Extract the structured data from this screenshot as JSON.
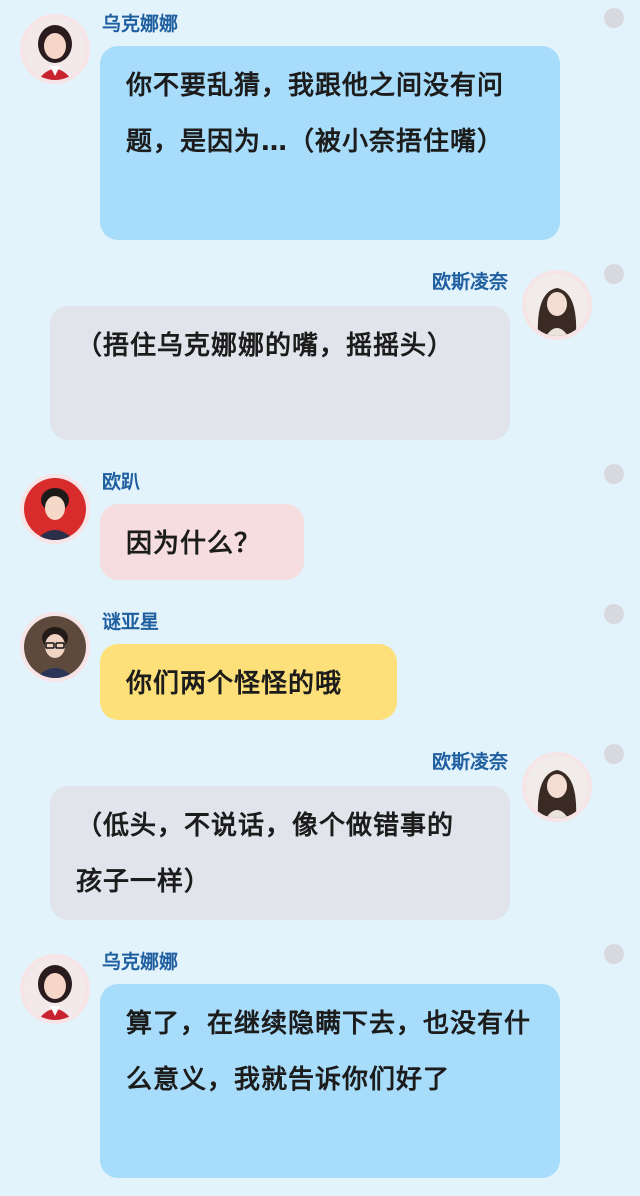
{
  "messages": [
    {
      "side": "left",
      "name": "乌克娜娜",
      "text": "你不要乱猜，我跟他之间没有问题，是因为…（被小奈捂住嘴）",
      "color": "blue",
      "avatar_icon": "avatar-female-red-uniform-icon"
    },
    {
      "side": "right",
      "name": "欧斯凌奈",
      "text": "（捂住乌克娜娜的嘴，摇摇头）",
      "color": "gray",
      "avatar_icon": "avatar-female-long-hair-icon"
    },
    {
      "side": "left",
      "name": "欧趴",
      "text": "因为什么？",
      "color": "pink",
      "avatar_icon": "avatar-male-red-background-icon"
    },
    {
      "side": "left",
      "name": "谜亚星",
      "text": "你们两个怪怪的哦",
      "color": "yellow",
      "avatar_icon": "avatar-male-glasses-icon"
    },
    {
      "side": "right",
      "name": "欧斯凌奈",
      "text": "（低头，不说话，像个做错事的孩子一样）",
      "color": "gray",
      "avatar_icon": "avatar-female-long-hair-icon"
    },
    {
      "side": "left",
      "name": "乌克娜娜",
      "text": "算了，在继续隐瞒下去，也没有什么意义，我就告诉你们好了",
      "color": "blue",
      "avatar_icon": "avatar-female-red-uniform-icon"
    }
  ],
  "colors": {
    "background": "#e3f3fc",
    "name_text": "#1f5f9f",
    "bubble_blue": "#a8dcfb",
    "bubble_gray": "#e1e5eb",
    "bubble_pink": "#f5dde0",
    "bubble_yellow": "#fde07a",
    "dot": "#d6dadf"
  }
}
